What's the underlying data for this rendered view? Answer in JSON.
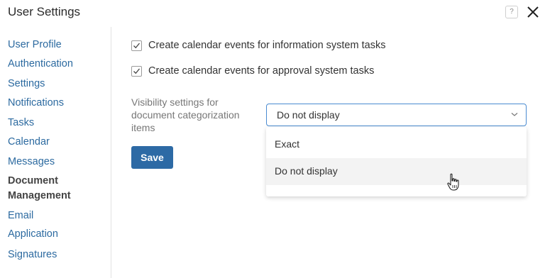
{
  "window": {
    "title": "User Settings",
    "help_icon_text": "?"
  },
  "sidebar": {
    "items": [
      {
        "label": "User Profile"
      },
      {
        "label": "Authentication"
      },
      {
        "label": "Settings"
      },
      {
        "label": "Notifications"
      },
      {
        "label": "Tasks"
      },
      {
        "label": "Calendar"
      },
      {
        "label": "Messages"
      },
      {
        "label": "Document Management",
        "line1": "Document",
        "line2": "Management",
        "active": true
      },
      {
        "label": "Email"
      },
      {
        "label": "Application"
      },
      {
        "label": "Signatures"
      }
    ]
  },
  "main": {
    "checkboxes": [
      {
        "label": "Create calendar events for information system tasks",
        "checked": true
      },
      {
        "label": "Create calendar events for approval system tasks",
        "checked": true
      }
    ],
    "visibility": {
      "label": "Visibility settings for document categorization items",
      "label_lines": [
        "Visibility settings for",
        "document categorization",
        "items"
      ],
      "selected": "Do not display",
      "options": [
        "Exact",
        "Do not display"
      ],
      "hovered_option": "Do not display"
    },
    "save_label": "Save"
  },
  "colors": {
    "link": "#2c6aa0",
    "primary": "#2d6aa5",
    "focus_border": "#4a8bd1"
  }
}
